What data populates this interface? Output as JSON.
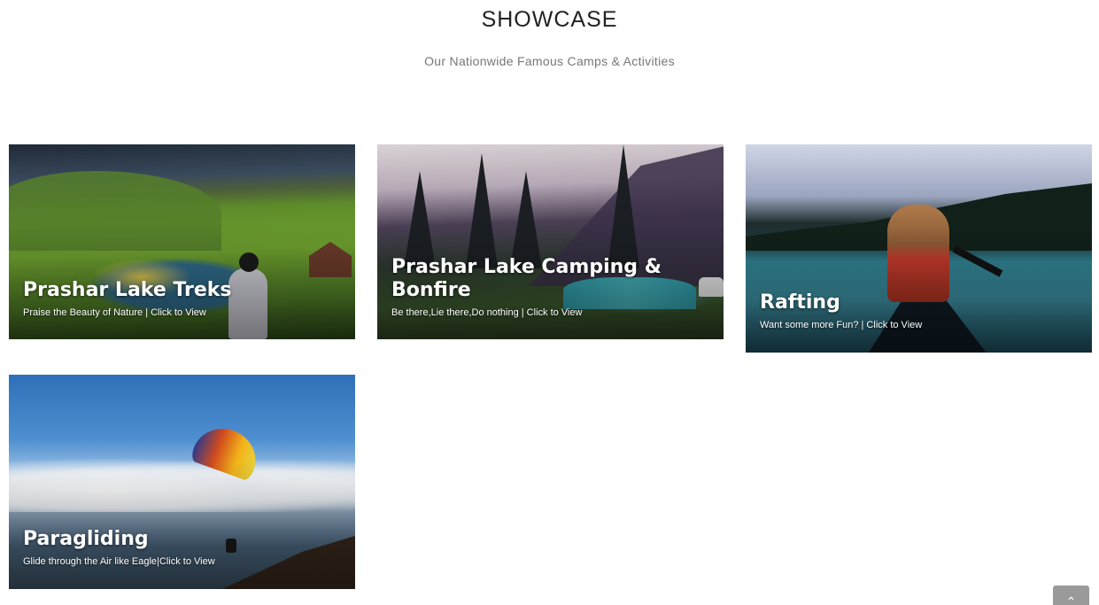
{
  "section": {
    "title": "SHOWCASE",
    "subtitle": "Our Nationwide Famous Camps & Activities"
  },
  "cards": [
    {
      "title": "Prashar Lake Treks",
      "description": "Praise the Beauty of Nature | Click to View"
    },
    {
      "title": "Prashar Lake Camping & Bonfire",
      "description": "Be there,Lie there,Do nothing | Click to View"
    },
    {
      "title": "Rafting",
      "description": "Want some more Fun? | Click to View"
    },
    {
      "title": "Paragliding",
      "description": "Glide through the Air like Eagle|Click to View"
    }
  ],
  "scroll_top": {
    "icon": "chevron-up-icon",
    "glyph": "⌃"
  }
}
